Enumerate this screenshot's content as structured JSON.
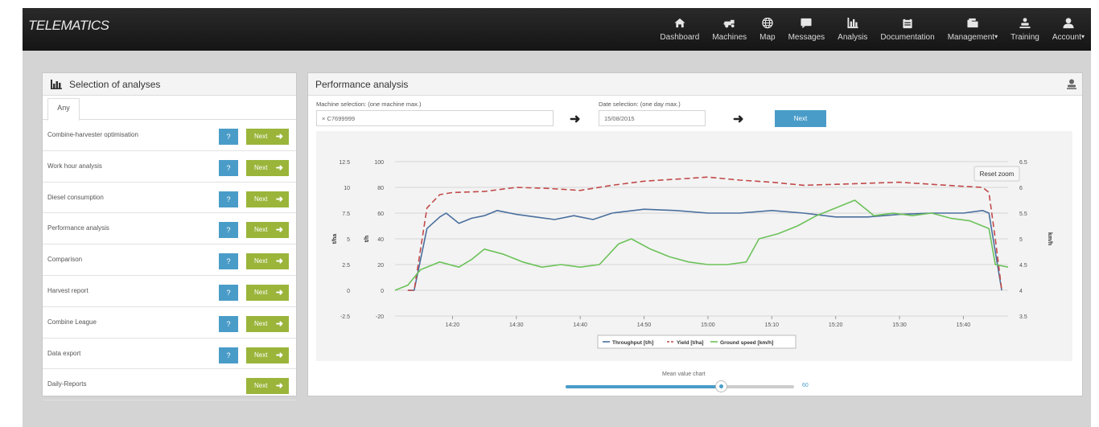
{
  "app": {
    "logo": "TELEMATICS"
  },
  "nav": [
    {
      "label": "Dashboard",
      "icon": "home-icon"
    },
    {
      "label": "Machines",
      "icon": "harvester-icon"
    },
    {
      "label": "Map",
      "icon": "globe-icon"
    },
    {
      "label": "Messages",
      "icon": "message-icon"
    },
    {
      "label": "Analysis",
      "icon": "bar-chart-icon"
    },
    {
      "label": "Documentation",
      "icon": "clipboard-icon"
    },
    {
      "label": "Management",
      "icon": "folder-icon",
      "dropdown": true
    },
    {
      "label": "Training",
      "icon": "training-icon"
    },
    {
      "label": "Account",
      "icon": "user-icon",
      "dropdown": true
    }
  ],
  "left_panel": {
    "title": "Selection of analyses",
    "tab": "Any",
    "help_label": "?",
    "next_label": "Next",
    "items": [
      {
        "label": "Combine-harvester optimisation",
        "help": true
      },
      {
        "label": "Work hour analysis",
        "help": true
      },
      {
        "label": "Diesel consumption",
        "help": true
      },
      {
        "label": "Performance analysis",
        "help": true
      },
      {
        "label": "Comparison",
        "help": true
      },
      {
        "label": "Harvest report",
        "help": true
      },
      {
        "label": "Combine League",
        "help": true
      },
      {
        "label": "Data export",
        "help": true
      },
      {
        "label": "Daily-Reports",
        "help": false
      }
    ]
  },
  "right_panel": {
    "title": "Performance analysis",
    "machine_label": "Machine selection: (one machine max.)",
    "machine_value": "× C7699999",
    "date_label": "Date selection: (one day max.)",
    "date_value": "15/08/2015",
    "next_label": "Next",
    "reset_zoom": "Reset zoom",
    "slider_label": "Mean value chart",
    "slider_value": "60",
    "slider_fraction": 0.68
  },
  "colors": {
    "throughput": "#4a6f9e",
    "yield": "#c24a4a",
    "speed": "#6cc259",
    "accent": "#4a9cc8",
    "next": "#9ab53a"
  },
  "chart_data": {
    "type": "line",
    "x_ticks": [
      "14:20",
      "14:30",
      "14:40",
      "14:50",
      "15:00",
      "15:10",
      "15:20",
      "15:30",
      "15:40"
    ],
    "xlim": [
      "14:11",
      "15:47"
    ],
    "axes": {
      "left_outer": {
        "label": "t/ha",
        "ticks": [
          "-2.5",
          "0",
          "2.5",
          "5",
          "7.5",
          "10",
          "12.5"
        ],
        "range": [
          -2.5,
          12.5
        ]
      },
      "left_inner": {
        "label": "t/h",
        "ticks": [
          "-20",
          "0",
          "20",
          "40",
          "60",
          "80",
          "100"
        ],
        "range": [
          -20,
          100
        ]
      },
      "right": {
        "label": "km/h",
        "ticks": [
          "3.5",
          "4",
          "4.5",
          "5",
          "5.5",
          "6",
          "6.5"
        ],
        "range": [
          3.5,
          6.5
        ]
      }
    },
    "series": [
      {
        "name": "Throughput [t/h]",
        "axis": "left_inner",
        "style": "solid",
        "x": [
          "14:13",
          "14:14",
          "14:16",
          "14:18",
          "14:19",
          "14:21",
          "14:23",
          "14:25",
          "14:27",
          "14:30",
          "14:33",
          "14:36",
          "14:39",
          "14:42",
          "14:45",
          "14:50",
          "14:55",
          "15:00",
          "15:05",
          "15:10",
          "15:15",
          "15:20",
          "15:25",
          "15:30",
          "15:35",
          "15:40",
          "15:43",
          "15:44",
          "15:45",
          "15:46"
        ],
        "y": [
          0,
          0,
          48,
          57,
          60,
          52,
          56,
          58,
          62,
          59,
          57,
          55,
          58,
          55,
          60,
          63,
          62,
          60,
          60,
          62,
          60,
          57,
          57,
          59,
          60,
          60,
          62,
          60,
          30,
          0
        ]
      },
      {
        "name": "Yield [t/ha]",
        "axis": "left_outer",
        "style": "dashed",
        "x": [
          "14:13",
          "14:14",
          "14:16",
          "14:18",
          "14:20",
          "14:25",
          "14:30",
          "14:35",
          "14:40",
          "14:45",
          "14:50",
          "14:55",
          "15:00",
          "15:05",
          "15:10",
          "15:15",
          "15:20",
          "15:25",
          "15:30",
          "15:35",
          "15:40",
          "15:43",
          "15:44",
          "15:45",
          "15:46"
        ],
        "y": [
          0,
          0,
          8.0,
          9.3,
          9.5,
          9.6,
          10.0,
          9.9,
          9.7,
          10.2,
          10.6,
          10.8,
          11.0,
          10.7,
          10.5,
          10.2,
          10.3,
          10.4,
          10.5,
          10.3,
          10.1,
          10.0,
          9.5,
          5.0,
          0
        ]
      },
      {
        "name": "Ground speed [km/h]",
        "axis": "right",
        "style": "solid",
        "x": [
          "14:11",
          "14:13",
          "14:15",
          "14:18",
          "14:21",
          "14:23",
          "14:25",
          "14:28",
          "14:31",
          "14:34",
          "14:37",
          "14:40",
          "14:43",
          "14:46",
          "14:48",
          "14:51",
          "14:54",
          "14:57",
          "15:00",
          "15:03",
          "15:06",
          "15:08",
          "15:11",
          "15:14",
          "15:17",
          "15:20",
          "15:23",
          "15:25",
          "15:26",
          "15:29",
          "15:32",
          "15:35",
          "15:38",
          "15:41",
          "15:44",
          "15:45",
          "15:47"
        ],
        "y": [
          4.0,
          4.1,
          4.4,
          4.55,
          4.45,
          4.6,
          4.8,
          4.7,
          4.55,
          4.45,
          4.5,
          4.45,
          4.5,
          4.9,
          5.0,
          4.8,
          4.65,
          4.55,
          4.5,
          4.5,
          4.55,
          5.0,
          5.1,
          5.25,
          5.45,
          5.6,
          5.75,
          5.55,
          5.45,
          5.5,
          5.45,
          5.5,
          5.4,
          5.35,
          5.2,
          4.5,
          4.45
        ]
      }
    ],
    "legend_position": "bottom",
    "grid": true
  }
}
